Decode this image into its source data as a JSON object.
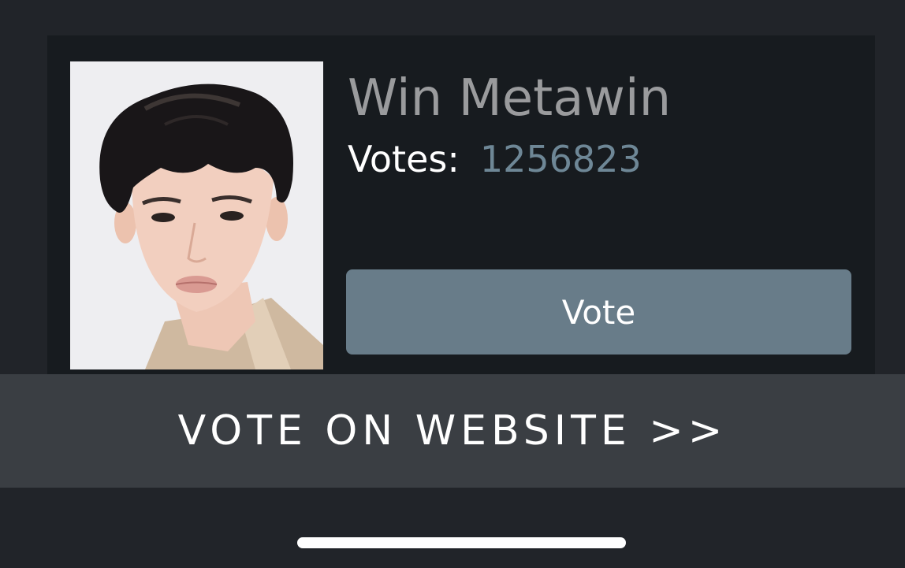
{
  "candidate": {
    "name": "Win Metawin",
    "votes_label": "Votes:",
    "votes_value": "1256823",
    "photo_icon": "portrait-photo"
  },
  "actions": {
    "vote_label": "Vote",
    "website_label": "VOTE ON WEBSITE >>"
  },
  "colors": {
    "background": "#212429",
    "card": "#171b1f",
    "name_text": "#9a9b9d",
    "votes_value": "#6e8796",
    "vote_button": "#687c89",
    "banner": "#3a3e43"
  }
}
